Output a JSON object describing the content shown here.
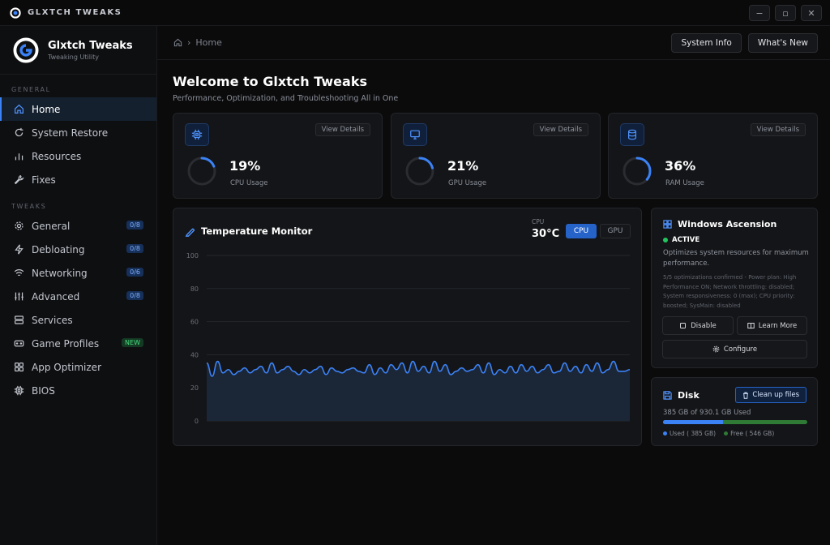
{
  "window": {
    "title": "GLXTCH TWEAKS",
    "controls": [
      "−",
      "▫",
      "✕"
    ]
  },
  "brand": {
    "name": "Glxtch Tweaks",
    "subtitle": "Tweaking Utility"
  },
  "sidebar": {
    "general_label": "GENERAL",
    "general_items": [
      {
        "label": "Home",
        "icon": "home-icon",
        "active": true
      },
      {
        "label": "System Restore",
        "icon": "restore-icon"
      },
      {
        "label": "Resources",
        "icon": "bar-chart-icon"
      },
      {
        "label": "Fixes",
        "icon": "wrench-icon"
      }
    ],
    "tweaks_label": "TWEAKS",
    "tweaks_items": [
      {
        "label": "General",
        "icon": "gear-icon",
        "badge": "0/8"
      },
      {
        "label": "Debloating",
        "icon": "lightning-icon",
        "badge": "0/8"
      },
      {
        "label": "Networking",
        "icon": "wifi-icon",
        "badge": "0/6"
      },
      {
        "label": "Advanced",
        "icon": "sliders-icon",
        "badge": "0/8"
      },
      {
        "label": "Services",
        "icon": "server-icon"
      },
      {
        "label": "Game Profiles",
        "icon": "gamepad-icon",
        "badge": "NEW"
      },
      {
        "label": "App Optimizer",
        "icon": "apps-icon"
      },
      {
        "label": "BIOS",
        "icon": "chip-icon"
      }
    ]
  },
  "header": {
    "breadcrumb": {
      "current": "Home",
      "separator": "›"
    },
    "system_info_label": "System Info",
    "whats_new_label": "What's New"
  },
  "welcome": {
    "title": "Welcome to Glxtch Tweaks",
    "subtitle": "Performance, Optimization, and Troubleshooting All in One"
  },
  "stats": [
    {
      "value": "19%",
      "percent": 19,
      "label": "CPU Usage",
      "view_label": "View Details",
      "icon": "cpu-icon"
    },
    {
      "value": "21%",
      "percent": 21,
      "label": "GPU Usage",
      "view_label": "View Details",
      "icon": "monitor-icon"
    },
    {
      "value": "36%",
      "percent": 36,
      "label": "RAM Usage",
      "view_label": "View Details",
      "icon": "database-icon"
    }
  ],
  "temperature": {
    "title": "Temperature Monitor",
    "source_label": "CPU",
    "current": "30°C",
    "toggle_cpu": "CPU",
    "toggle_gpu": "GPU",
    "selected": "CPU"
  },
  "chart_data": {
    "type": "area",
    "title": "Temperature Monitor",
    "y_ticks": [
      "100",
      "80",
      "60",
      "40",
      "20",
      "0"
    ],
    "ylim": [
      0,
      100
    ],
    "grid": true,
    "color": "#3b82f6",
    "values": [
      35,
      27,
      36,
      29,
      31,
      28,
      30,
      32,
      29,
      31,
      33,
      29,
      35,
      29,
      31,
      33,
      30,
      28,
      31,
      29,
      31,
      33,
      28,
      32,
      30,
      29,
      31,
      32,
      30,
      29,
      34,
      28,
      32,
      29,
      34,
      31,
      35,
      29,
      36,
      30,
      33,
      29,
      36,
      30,
      34,
      28,
      30,
      32,
      30,
      31,
      34,
      29,
      35,
      28,
      31,
      29,
      33,
      29,
      34,
      30,
      33,
      29,
      31,
      34,
      29,
      30,
      35,
      30,
      33,
      29,
      34,
      30,
      35,
      29,
      31,
      36,
      30,
      30,
      31
    ]
  },
  "ascension": {
    "title": "Windows Ascension",
    "status": "ACTIVE",
    "status_color": "#22c55e",
    "description": "Optimizes system resources for maximum performance.",
    "detail": "5/5 optimizations confirmed - Power plan: High Performance ON; Network throttling: disabled; System responsiveness: 0 (max); CPU priority: boosted; SysMain: disabled",
    "disable_label": "Disable",
    "learn_more_label": "Learn More",
    "configure_label": "Configure"
  },
  "disk": {
    "title": "Disk",
    "clean_label": "Clean up files",
    "used_text": "385 GB of 930.1 GB Used",
    "used_fraction": 0.414,
    "legend_used": "Used ( 385 GB)",
    "legend_free": "Free ( 546 GB)",
    "used_color": "#3b82f6",
    "free_color": "#2f7a35"
  }
}
